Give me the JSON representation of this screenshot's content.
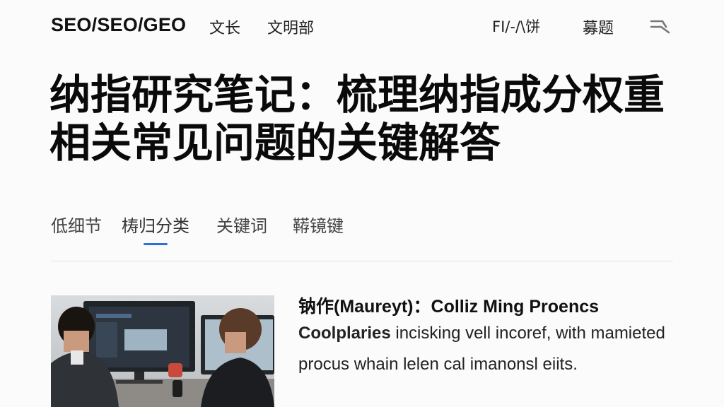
{
  "site": {
    "logo": "SEO/SEO/GEO",
    "nav": {
      "wenzhang": "文长",
      "wenmingbu": "文明部",
      "right1": "FI/-/\\饼",
      "right2": "募题"
    }
  },
  "article": {
    "headline": "纳指研究笔记：梳理纳指成分权重相关常见问题的关键解答",
    "tabs": [
      "低细节",
      "梼归分类",
      "关键词",
      "鞯镜键"
    ],
    "active_tab_index": 1
  },
  "feature": {
    "title": "钠作(Maureyt)：Colliz Ming Proencs",
    "body_bold": "Coolplaries",
    "body_rest": " incisking vell incoref, with mamieted procus whain lelen cal imanonsl eiits."
  },
  "colors": {
    "accent": "#2f6fd8",
    "divider": "#e2e2e2",
    "text": "#111111"
  },
  "icons": {
    "search": "search-icon"
  }
}
